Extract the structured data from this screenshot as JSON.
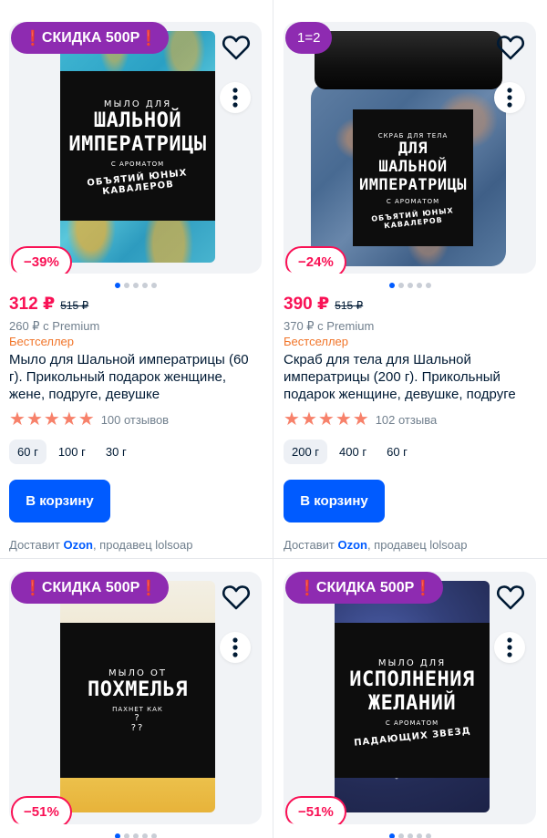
{
  "products": [
    {
      "promo": {
        "mark": "❗",
        "text": "СКИДКА 500Р",
        "mark_end": "❗"
      },
      "label": {
        "top": "МЫЛО ДЛЯ",
        "line1": "ШАЛЬНОЙ",
        "line2": "ИМПЕРАТРИЦЫ",
        "small": "С АРОМАТОМ",
        "arc": "ОБЪЯТИЙ ЮНЫХ КАВАЛЕРОВ"
      },
      "discount": "−39%",
      "price": "312 ₽",
      "old_price": "515 ₽",
      "premium": "260 ₽ с Premium",
      "tag": "Бестселлер",
      "title": "Мыло для Шальной императрицы (60 г). Прикольный подарок женщине, жене, подруге, девушке",
      "stars": 5,
      "reviews": "100 отзывов",
      "sizes": [
        "60 г",
        "100 г",
        "30 г"
      ],
      "selected_size": 0,
      "cart": "В корзину",
      "delivery": {
        "prefix": "Доставит ",
        "brand": "Ozon",
        "suffix": ", продавец lolsoap"
      },
      "art": "soap-blue"
    },
    {
      "promo_deal": "1=2",
      "label": {
        "top": "СКРАБ ДЛЯ ТЕЛА",
        "line0": "ДЛЯ",
        "line1": "ШАЛЬНОЙ",
        "line2": "ИМПЕРАТРИЦЫ",
        "small": "С АРОМАТОМ",
        "arc": "ОБЪЯТИЙ ЮНЫХ КАВАЛЕРОВ"
      },
      "discount": "−24%",
      "price": "390 ₽",
      "old_price": "515 ₽",
      "premium": "370 ₽ с Premium",
      "tag": "Бестселлер",
      "title": "Скраб для тела для Шальной императрицы (200 г). Прикольный подарок женщине, девушке, подруге",
      "stars": 5,
      "reviews": "102 отзыва",
      "sizes": [
        "200 г",
        "400 г",
        "60 г"
      ],
      "selected_size": 0,
      "cart": "В корзину",
      "delivery": {
        "prefix": "Доставит ",
        "brand": "Ozon",
        "suffix": ", продавец lolsoap"
      },
      "art": "scrub-jar"
    },
    {
      "promo": {
        "mark": "❗",
        "text": "СКИДКА 500Р",
        "mark_end": "❗"
      },
      "label": {
        "top": "МЫЛО ОТ",
        "line1": "ПОХМЕЛЬЯ",
        "small": "ПАХНЕТ КАК",
        "q1": "?",
        "q2": "??"
      },
      "discount": "−51%",
      "art": "soap-yellow"
    },
    {
      "promo": {
        "mark": "❗",
        "text": "СКИДКА 500Р",
        "mark_end": "❗"
      },
      "label": {
        "top": "МЫЛО ДЛЯ",
        "line1": "ИСПОЛНЕНИЯ",
        "line2": "ЖЕЛАНИЙ",
        "small": "С АРОМАТОМ",
        "arc": "ПАДАЮЩИХ ЗВЕЗД"
      },
      "discount": "−51%",
      "art": "soap-galaxy"
    }
  ],
  "colors": {
    "accent": "#005bff",
    "price": "#f91155",
    "bestseller": "#f1752a",
    "promo": "#8e2bb1",
    "star": "#f7816a"
  },
  "icons": {
    "favorite": "heart-outline-icon",
    "more": "vertical-dots-icon",
    "rating": "star-icon"
  }
}
